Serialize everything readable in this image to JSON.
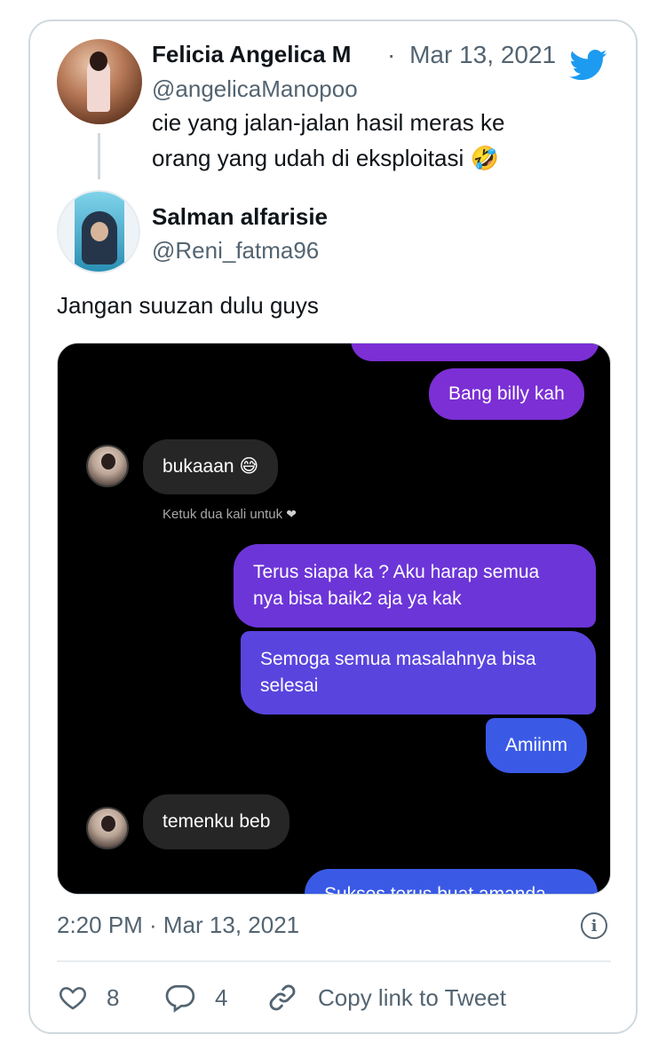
{
  "parent_tweet": {
    "display_name": "Felicia Angelica M",
    "separator": "·",
    "date": "Mar 13, 2021",
    "handle": "@angelicaManopoo",
    "text_line1": "cie yang jalan-jalan hasil meras ke",
    "text_line2": "orang yang udah di eksploitasi 🤣"
  },
  "reply_tweet": {
    "display_name": "Salman alfarisie",
    "handle": "@Reni_fatma96",
    "text": "Jangan suuzan dulu guys"
  },
  "chat": {
    "messages": [
      {
        "from": "me",
        "text": "Bang billy kah"
      },
      {
        "from": "other",
        "text": "bukaaan 😅"
      },
      {
        "from": "me",
        "line1": "Terus siapa ka ? Aku harap semua",
        "line2": "nya bisa baik2 aja ya kak"
      },
      {
        "from": "me",
        "line1": "Semoga semua masalahnya bisa",
        "line2": "selesai"
      },
      {
        "from": "me",
        "text": "Amiinm"
      },
      {
        "from": "other",
        "text": "temenku beb"
      },
      {
        "from": "me",
        "text": "Sukses terus buat amanda"
      }
    ],
    "double_tap_hint": "Ketuk dua kali untuk",
    "heart_icon": "❤"
  },
  "footer": {
    "timestamp": "2:20 PM · Mar 13, 2021",
    "info_icon": "i",
    "likes": "8",
    "replies": "4",
    "copy_link_label": "Copy link to Tweet"
  },
  "colors": {
    "twitter_blue": "#1d9bf0",
    "text_primary": "#0f1419",
    "text_secondary": "#536471",
    "border": "#cfd9de",
    "bubble_incoming": "#262626",
    "bubble_purple": "#7b2fd4",
    "bubble_blue": "#3a5ae6"
  }
}
